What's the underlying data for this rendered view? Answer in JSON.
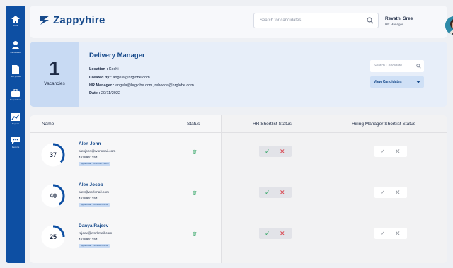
{
  "app": {
    "name": "Zappyhire"
  },
  "sidebar": {
    "items": [
      {
        "label": "Home",
        "icon": "home-icon"
      },
      {
        "label": "Candidates",
        "icon": "user-icon"
      },
      {
        "label": "Job profile",
        "icon": "document-icon"
      },
      {
        "label": "Requisitions",
        "icon": "briefcase-icon"
      },
      {
        "label": "Reports",
        "icon": "chart-icon"
      },
      {
        "label": "Reports",
        "icon": "chat-icon"
      }
    ]
  },
  "header": {
    "search_placeholder": "Search for candidates",
    "user_name": "Revathi Sree",
    "user_role": "HR Manager"
  },
  "job": {
    "vacancies_count": "1",
    "vacancies_label": "Vacancies",
    "title": "Delivery Manager",
    "location_label": "Location :",
    "location": "Kochi",
    "created_by_label": "Created by :",
    "created_by": "angela@hrglobe.com",
    "hr_manager_label": "HR Manager :",
    "hr_manager": "angela@hrglobe.com, rebocca@hrglobe.com",
    "date_label": "Date :",
    "date": "20/11/2022",
    "candidate_search_placeholder": "Search Candidate",
    "view_candidates_label": "View Candidates"
  },
  "table": {
    "headers": {
      "name": "Name",
      "status": "Status",
      "hr": "HR Shortlist Status",
      "hm": "Hiring Manager Shortlist Status"
    },
    "rows": [
      {
        "score": 37,
        "name": "Alen John",
        "email": "alenjohn@workmail.com",
        "phone": "4578961254",
        "applied": "Applied Date : 16/11/2022  3:20PM"
      },
      {
        "score": 40,
        "name": "Alex Jocob",
        "email": "alex@workmail.com",
        "phone": "4578961254",
        "applied": "Applied Date : 16/4/2022  3:20PM"
      },
      {
        "score": 25,
        "name": "Danya Rajeev",
        "email": "rajeev@workmail.com",
        "phone": "4578961254",
        "applied": "Applied Date : 13/4/2022  3:20PM"
      }
    ]
  },
  "colors": {
    "primary": "#0d4fa3",
    "accent": "#174a8b",
    "approve": "#3aa86b",
    "reject": "#d9404a"
  }
}
